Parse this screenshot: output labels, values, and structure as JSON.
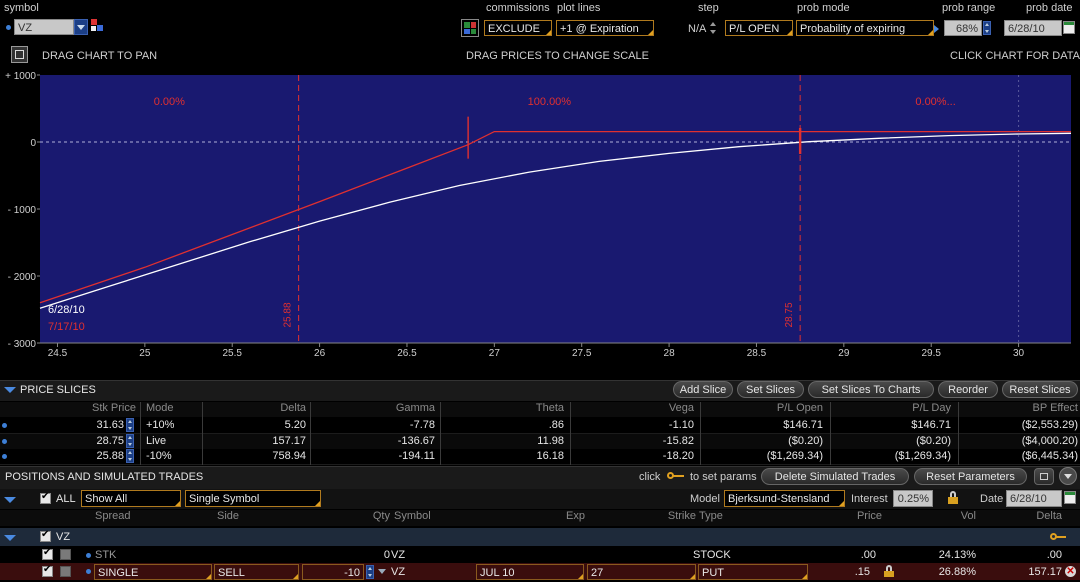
{
  "toolbar": {
    "symbol_label": "symbol",
    "symbol_value": "VZ",
    "commissions_label": "commissions",
    "commissions_value": "EXCLUDE",
    "plot_lines_label": "plot lines",
    "plot_lines_value": "+1 @ Expiration",
    "step_label": "step",
    "step_value": "N/A",
    "pl_mode_value": "P/L OPEN",
    "prob_mode_label": "prob mode",
    "prob_mode_value": "Probability of expiring",
    "prob_range_label": "prob range",
    "prob_range_value": "68%",
    "prob_date_label": "prob date",
    "prob_date_value": "6/28/10"
  },
  "chart_hints": {
    "drag_pan": "DRAG CHART TO PAN",
    "drag_scale": "DRAG PRICES TO CHANGE SCALE",
    "click_data": "CLICK CHART FOR DATA"
  },
  "colors": {
    "plot_bg": "#191970",
    "expiration_line": "#e03030",
    "today_line": "#ffffff",
    "accent_blue": "#3d7fd6",
    "orange_flag": "#e0a020"
  },
  "chart_data": {
    "type": "line",
    "xlim": [
      24.4,
      30.3
    ],
    "ylim": [
      -3000,
      1000
    ],
    "x_ticks": [
      "24.5",
      "25",
      "25.5",
      "26",
      "26.5",
      "27",
      "27.5",
      "28",
      "28.5",
      "29",
      "29.5",
      "30"
    ],
    "x_tick_values": [
      24.5,
      25,
      25.5,
      26,
      26.5,
      27,
      27.5,
      28,
      28.5,
      29,
      29.5,
      30
    ],
    "y_ticks": [
      "+ 1000",
      "0",
      "- 1000",
      "- 2000",
      "- 3000"
    ],
    "y_tick_values": [
      1000,
      0,
      -1000,
      -2000,
      -3000
    ],
    "prob_labels": [
      "0.00%",
      "100.00%",
      "0.00%..."
    ],
    "slices": [
      {
        "price": 25.88,
        "label": "25.88"
      },
      {
        "price": 28.75,
        "label": "28.75"
      }
    ],
    "legend": [
      "6/28/10",
      "7/17/10"
    ],
    "series": [
      {
        "name": "6/28/10",
        "color": "#ffffff",
        "x": [
          24.4,
          24.8,
          25.2,
          25.6,
          26.0,
          26.4,
          26.8,
          27.2,
          27.6,
          28.0,
          28.4,
          28.8,
          29.2,
          29.6,
          30.0,
          30.3
        ],
        "y": [
          -2480,
          -2150,
          -1820,
          -1490,
          -1180,
          -900,
          -650,
          -450,
          -290,
          -170,
          -70,
          5,
          55,
          95,
          120,
          130
        ]
      },
      {
        "name": "7/17/10",
        "color": "#e03030",
        "x": [
          24.4,
          25.0,
          25.5,
          26.0,
          26.5,
          26.85,
          27.0,
          27.5,
          28.0,
          28.5,
          29.0,
          29.5,
          30.0,
          30.3
        ],
        "y": [
          -2400,
          -1870,
          -1380,
          -890,
          -390,
          -40,
          155,
          155,
          155,
          155,
          155,
          155,
          155,
          155
        ]
      }
    ]
  },
  "price_slices": {
    "title": "PRICE SLICES",
    "buttons": [
      "Add Slice",
      "Set Slices",
      "Set Slices To Charts",
      "Reorder",
      "Reset Slices"
    ],
    "columns": [
      "Stk Price",
      "Mode",
      "Delta",
      "Gamma",
      "Theta",
      "Vega",
      "P/L Open",
      "P/L Day",
      "BP Effect"
    ],
    "rows": [
      {
        "stk": "31.63",
        "mode": "+10%",
        "delta": "5.20",
        "gamma": "-7.78",
        "theta": ".86",
        "vega": "-1.10",
        "pl_open": "$146.71",
        "pl_day": "$146.71",
        "bp": "($2,553.29)"
      },
      {
        "stk": "28.75",
        "mode": "Live",
        "delta": "157.17",
        "gamma": "-136.67",
        "theta": "11.98",
        "vega": "-15.82",
        "pl_open": "($0.20)",
        "pl_day": "($0.20)",
        "bp": "($4,000.20)"
      },
      {
        "stk": "25.88",
        "mode": "-10%",
        "delta": "758.94",
        "gamma": "-194.11",
        "theta": "16.18",
        "vega": "-18.20",
        "pl_open": "($1,269.34)",
        "pl_day": "($1,269.34)",
        "bp": "($6,445.34)"
      }
    ]
  },
  "positions": {
    "title": "POSITIONS AND SIMULATED TRADES",
    "click_hint": "click",
    "set_params_hint": "to set params",
    "delete_btn": "Delete Simulated Trades",
    "reset_btn": "Reset Parameters",
    "all_label": "ALL",
    "show_value": "Show All",
    "group_value": "Single Symbol",
    "model_label": "Model",
    "model_value": "Bjerksund-Stensland",
    "interest_label": "Interest",
    "interest_value": "0.25%",
    "date_label": "Date",
    "date_value": "6/28/10",
    "columns": [
      "Spread",
      "Side",
      "Qty",
      "Symbol",
      "Exp",
      "Strike",
      "Type",
      "Price",
      "Vol",
      "Delta"
    ],
    "group": "VZ",
    "rows": [
      {
        "spread": "STK",
        "side": "",
        "qty": "0",
        "symbol": "VZ",
        "exp": "",
        "strike": "",
        "type": "STOCK",
        "price": ".00",
        "vol": "24.13%",
        "delta": ".00"
      },
      {
        "spread": "SINGLE",
        "side": "SELL",
        "qty": "-10",
        "symbol": "VZ",
        "exp": "JUL 10",
        "strike": "27",
        "type": "PUT",
        "price": ".15",
        "vol": "26.88%",
        "delta": "157.17"
      }
    ]
  }
}
